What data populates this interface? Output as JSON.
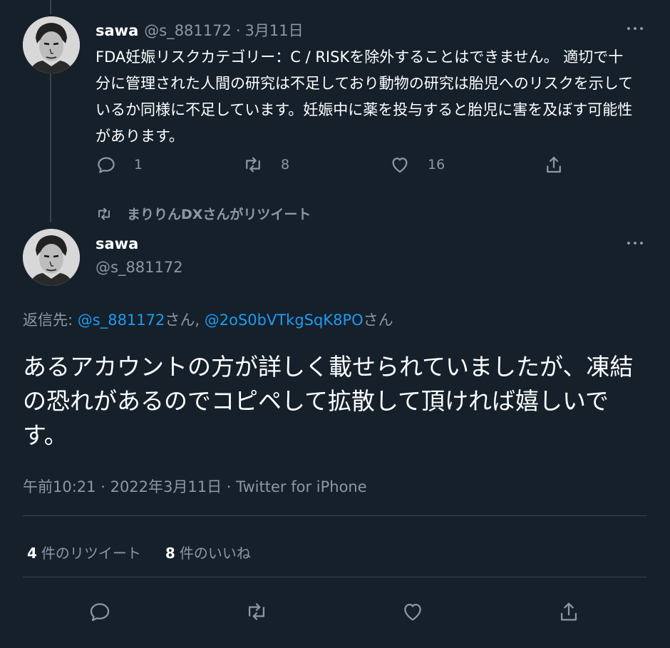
{
  "tweet1": {
    "name": "sawa",
    "handle": "@s_881172",
    "separator": "·",
    "date": "3月11日",
    "text": "FDA妊娠リスクカテゴリー：C / RISKを除外することはできません。 適切で十分に管理された人間の研究は不足しており動物の研究は胎児へのリスクを示しているか同様に不足しています。妊娠中に薬を投与すると胎児に害を及ぼす可能性があります。",
    "reply_count": "1",
    "retweet_count": "8",
    "like_count": "16"
  },
  "retweet_context": {
    "text": "まりりんDXさんがリツイート"
  },
  "tweet2": {
    "name": "sawa",
    "handle": "@s_881172",
    "reply_prefix": "返信先: ",
    "reply_user1": "@s_881172",
    "reply_suffix1": "さん, ",
    "reply_user2": "@2oS0bVTkgSqK8PO",
    "reply_suffix2": "さん",
    "text": "あるアカウントの方が詳しく載せられていましたが、凍結の恐れがあるのでコピペして拡散して頂ければ嬉しいです。",
    "time": "午前10:21",
    "date": "2022年3月11日",
    "source": "Twitter for iPhone",
    "retweets_count": "4",
    "retweets_label": "件のリツイート",
    "likes_count": "8",
    "likes_label": "件のいいね"
  },
  "icons": [
    "more-icon",
    "reply-icon",
    "retweet-icon",
    "like-icon",
    "share-icon"
  ],
  "colors": {
    "background": "#15202b",
    "text": "#ffffff",
    "muted": "#8b98a5",
    "link": "#1d9bf0",
    "divider": "#38444d"
  }
}
